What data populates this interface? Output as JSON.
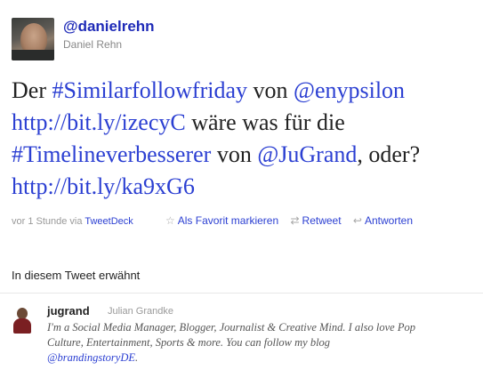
{
  "header": {
    "handle": "@danielrehn",
    "real_name": "Daniel Rehn"
  },
  "tweet": {
    "parts": {
      "p1": "Der ",
      "hashtag1": "#Similarfollowfriday",
      "p2": " von ",
      "mention1": "@enypsilon",
      "p3": " ",
      "link1": "http://bit.ly/izecyC",
      "p4": " wäre was für die ",
      "hashtag2": "#Timelineverbesserer",
      "p5": " von ",
      "mention2": "@JuGrand",
      "p6": ", oder? ",
      "link2": "http://bit.ly/ka9xG6"
    }
  },
  "meta": {
    "time": "vor 1 Stunde via",
    "source": "TweetDeck"
  },
  "actions": {
    "favorite": {
      "label": "Als Favorit markieren",
      "icon": "star-icon"
    },
    "retweet": {
      "label": "Retweet",
      "icon": "retweet-icon"
    },
    "reply": {
      "label": "Antworten",
      "icon": "reply-icon"
    }
  },
  "mentioned": {
    "title": "In diesem Tweet erwähnt",
    "user": {
      "screen_name": "jugrand",
      "full_name": "Julian Grandke",
      "bio_text": "I'm a Social Media Manager, Blogger, Journalist & Creative Mind. I also love Pop Culture, Entertainment, Sports & more. You can follow my blog ",
      "bio_link": "@brandingstoryDE",
      "bio_end": "."
    }
  },
  "colors": {
    "link": "#2b3fd2",
    "handle": "#1f2bb8",
    "muted": "#999999",
    "text": "#222222"
  }
}
